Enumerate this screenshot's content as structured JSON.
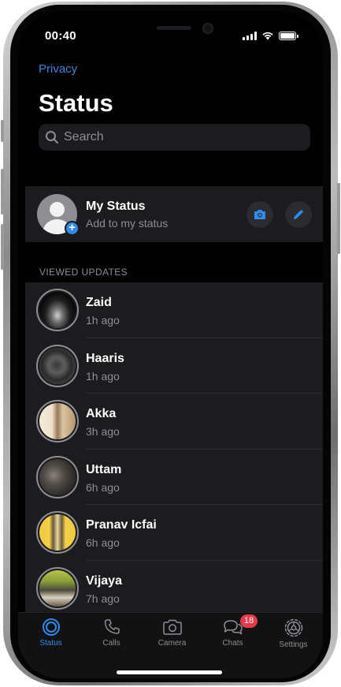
{
  "status_bar": {
    "time": "00:40"
  },
  "nav": {
    "back_link": "Privacy"
  },
  "page": {
    "title": "Status"
  },
  "search": {
    "placeholder": "Search"
  },
  "my_status": {
    "name": "My Status",
    "subtitle": "Add to my status"
  },
  "section": {
    "viewed_updates": "VIEWED UPDATES"
  },
  "viewed_updates": [
    {
      "name": "Zaid",
      "time": "1h ago"
    },
    {
      "name": "Haaris",
      "time": "1h ago"
    },
    {
      "name": "Akka",
      "time": "3h ago"
    },
    {
      "name": "Uttam",
      "time": "6h ago"
    },
    {
      "name": "Pranav Icfai",
      "time": "6h ago"
    },
    {
      "name": "Vijaya",
      "time": "7h ago"
    }
  ],
  "tabs": [
    {
      "label": "Status",
      "icon": "status-ring-icon",
      "active": true
    },
    {
      "label": "Calls",
      "icon": "phone-icon"
    },
    {
      "label": "Camera",
      "icon": "camera-icon"
    },
    {
      "label": "Chats",
      "icon": "chat-bubbles-icon",
      "badge": "18"
    },
    {
      "label": "Settings",
      "icon": "gear-icon"
    }
  ],
  "colors": {
    "accent": "#2f8bf0",
    "link": "#3b82d6",
    "badge": "#e5394a",
    "cell": "#1c1c1e",
    "background": "#000000"
  }
}
